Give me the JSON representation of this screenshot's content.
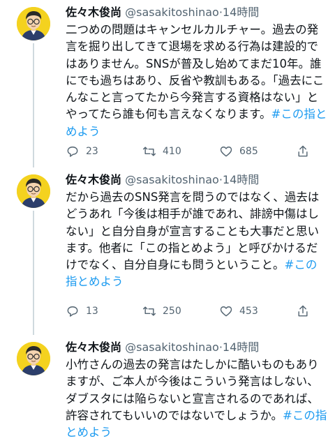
{
  "tweets": [
    {
      "name": "佐々木俊尚",
      "handle": "@sasakitoshinao",
      "dot": "·",
      "time": "14時間",
      "text": "二つめの問題はキャンセルカルチャー。過去の発言を掘り出してきて退場を求める行為は建設的ではありません。SNSが普及し始めてまだ10年。誰にでも過ちはあり、反省や教訓もある。「過去にこんなこと言ってたから今発言する資格はない」とやってたら誰も何も言えなくなります。",
      "hashtag": "#この指とめよう",
      "replies": "23",
      "retweets": "410",
      "likes": "685"
    },
    {
      "name": "佐々木俊尚",
      "handle": "@sasakitoshinao",
      "dot": "·",
      "time": "14時間",
      "text": "だから過去のSNS発言を問うのではなく、過去はどうあれ「今後は相手が誰であれ、誹謗中傷はしない」と自分自身が宣言することも大事だと思います。他者に「この指とめよう」と呼びかけるだけでなく、自分自身にも問うということ。",
      "hashtag": "#この指とめよう",
      "replies": "13",
      "retweets": "250",
      "likes": "453"
    },
    {
      "name": "佐々木俊尚",
      "handle": "@sasakitoshinao",
      "dot": "·",
      "time": "14時間",
      "text": "小竹さんの過去の発言はたしかに酷いものもありますが、ご本人が今後はこういう発言はしない、ダブスタには陥らないと宣言されるのであれば、許容されてもいいのではないでしょうか。",
      "hashtag": "#この指とめよう"
    }
  ],
  "icons": {
    "reply": "reply-icon",
    "retweet": "retweet-icon",
    "like": "like-icon",
    "share": "share-icon",
    "avatar": "avatar-illustration"
  },
  "colors": {
    "text": "#0f1419",
    "secondary": "#536471",
    "hashtag": "#1d9bf0",
    "avatar_bg": "#f4d21f"
  }
}
